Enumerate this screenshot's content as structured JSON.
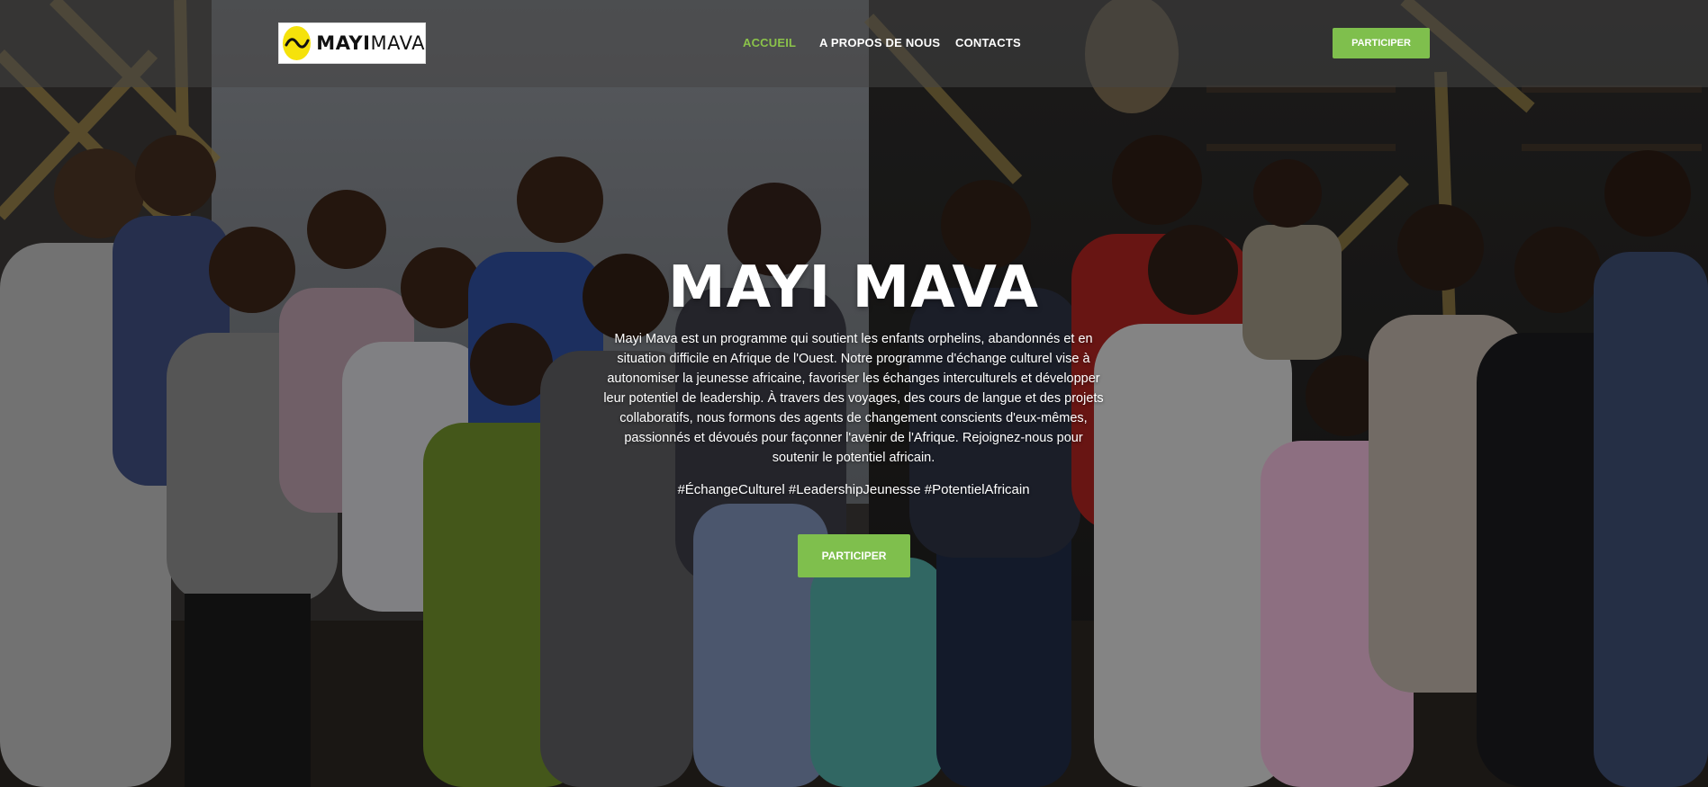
{
  "header": {
    "logo_text_bold": "MAYI",
    "logo_text_light": "MAVA",
    "nav": [
      {
        "label": "ACCUEIL",
        "active": true
      },
      {
        "label": "A PROPOS DE NOUS",
        "active": false
      },
      {
        "label": "CONTACTS",
        "active": false
      }
    ],
    "cta_label": "PARTICIPER"
  },
  "hero": {
    "title": "MAYI MAVA",
    "description": "Mayi Mava est un programme qui soutient les enfants orphelins, abandonnés et en situation difficile en Afrique de l'Ouest. Notre programme d'échange culturel vise à autonomiser la jeunesse africaine, favoriser les échanges interculturels et développer leur potentiel de leadership. À travers des voyages, des cours de langue et des projets collaboratifs, nous formons des agents de changement conscients d'eux-mêmes, passionnés et dévoués pour façonner l'avenir de l'Afrique. Rejoignez-nous pour soutenir le potentiel africain.",
    "hashtags": "#ÉchangeCulturel #LeadershipJeunesse #PotentielAfricain",
    "cta_label": "PARTICIPER"
  },
  "colors": {
    "accent": "#7fbf4d",
    "active_nav": "#8bc34a",
    "logo_mark": "#f5e20b"
  },
  "icons": {
    "logo_mark": "wave-logo-icon"
  }
}
